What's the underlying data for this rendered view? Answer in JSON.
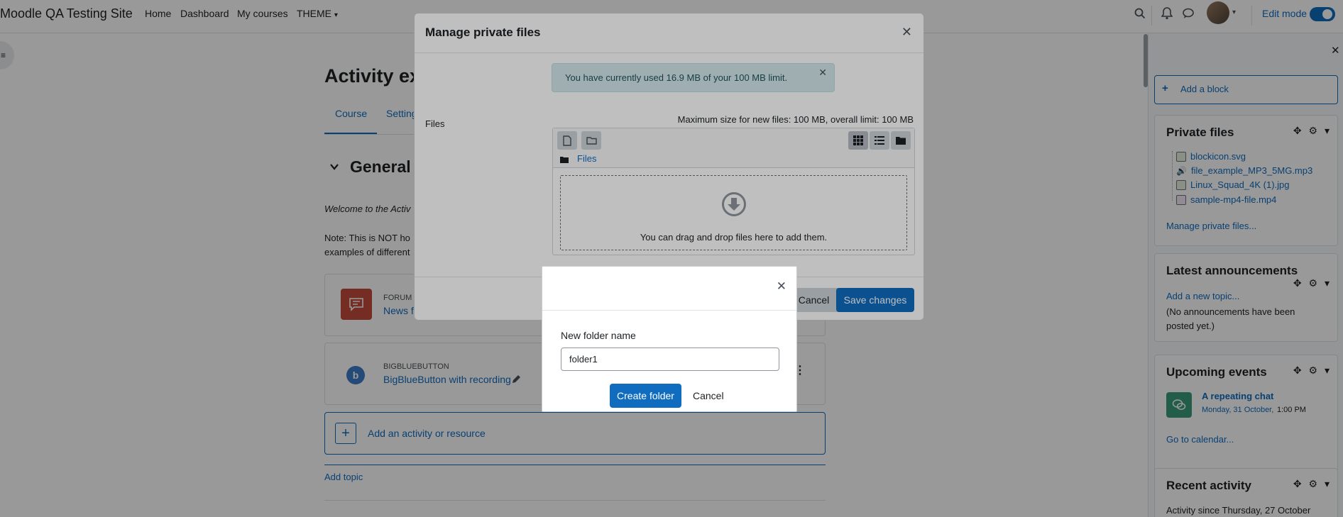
{
  "navbar": {
    "site_name": "Moodle QA Testing Site",
    "links": [
      "Home",
      "Dashboard",
      "My courses",
      "THEME"
    ],
    "edit_mode_label": "Edit mode"
  },
  "course": {
    "title": "Activity ex",
    "tabs": [
      "Course",
      "Setting"
    ],
    "section_title": "General",
    "welcome_text": "Welcome to the Activ",
    "note_line1": "Note: This is NOT ho",
    "note_line2": "examples of different",
    "activities": [
      {
        "type_label": "FORUM",
        "name": "News fo"
      },
      {
        "type_label": "BIGBLUEBUTTON",
        "name": "BigBlueButton with recording"
      }
    ],
    "add_activity_label": "Add an activity or resource",
    "add_topic_label": "Add topic"
  },
  "drawer": {
    "add_block_label": "Add a block",
    "private_files": {
      "title": "Private files",
      "files": [
        "blockicon.svg",
        "file_example_MP3_5MG.mp3",
        "Linux_Squad_4K (1).jpg",
        "sample-mp4-file.mp4"
      ],
      "manage_link": "Manage private files..."
    },
    "announcements": {
      "title": "Latest announcements",
      "add_link": "Add a new topic...",
      "empty_text": "(No announcements have been posted yet.)"
    },
    "upcoming": {
      "title": "Upcoming events",
      "event_name": "A repeating chat",
      "event_date": "Monday, 31 October,",
      "event_time": "1:00 PM",
      "calendar_link": "Go to calendar..."
    },
    "recent": {
      "title": "Recent activity",
      "since_text": "Activity since Thursday, 27 October"
    }
  },
  "modal": {
    "title": "Manage private files",
    "alert_text": "You have currently used 16.9 MB of your 100 MB limit.",
    "files_label": "Files",
    "max_size_text": "Maximum size for new files: 100 MB, overall limit: 100 MB",
    "breadcrumb": "Files",
    "dropzone_text": "You can drag and drop files here to add them.",
    "cancel_label": "Cancel",
    "save_label": "Save changes"
  },
  "folder_dialog": {
    "field_label": "New folder name",
    "field_value": "folder1",
    "create_label": "Create folder",
    "cancel_label": "Cancel"
  },
  "colors": {
    "accent": "#0f6cbf",
    "forum_icon_bg": "#c44a3a",
    "bbb_icon_bg": "#3d7cc9",
    "chat_icon_bg": "#399b79"
  }
}
